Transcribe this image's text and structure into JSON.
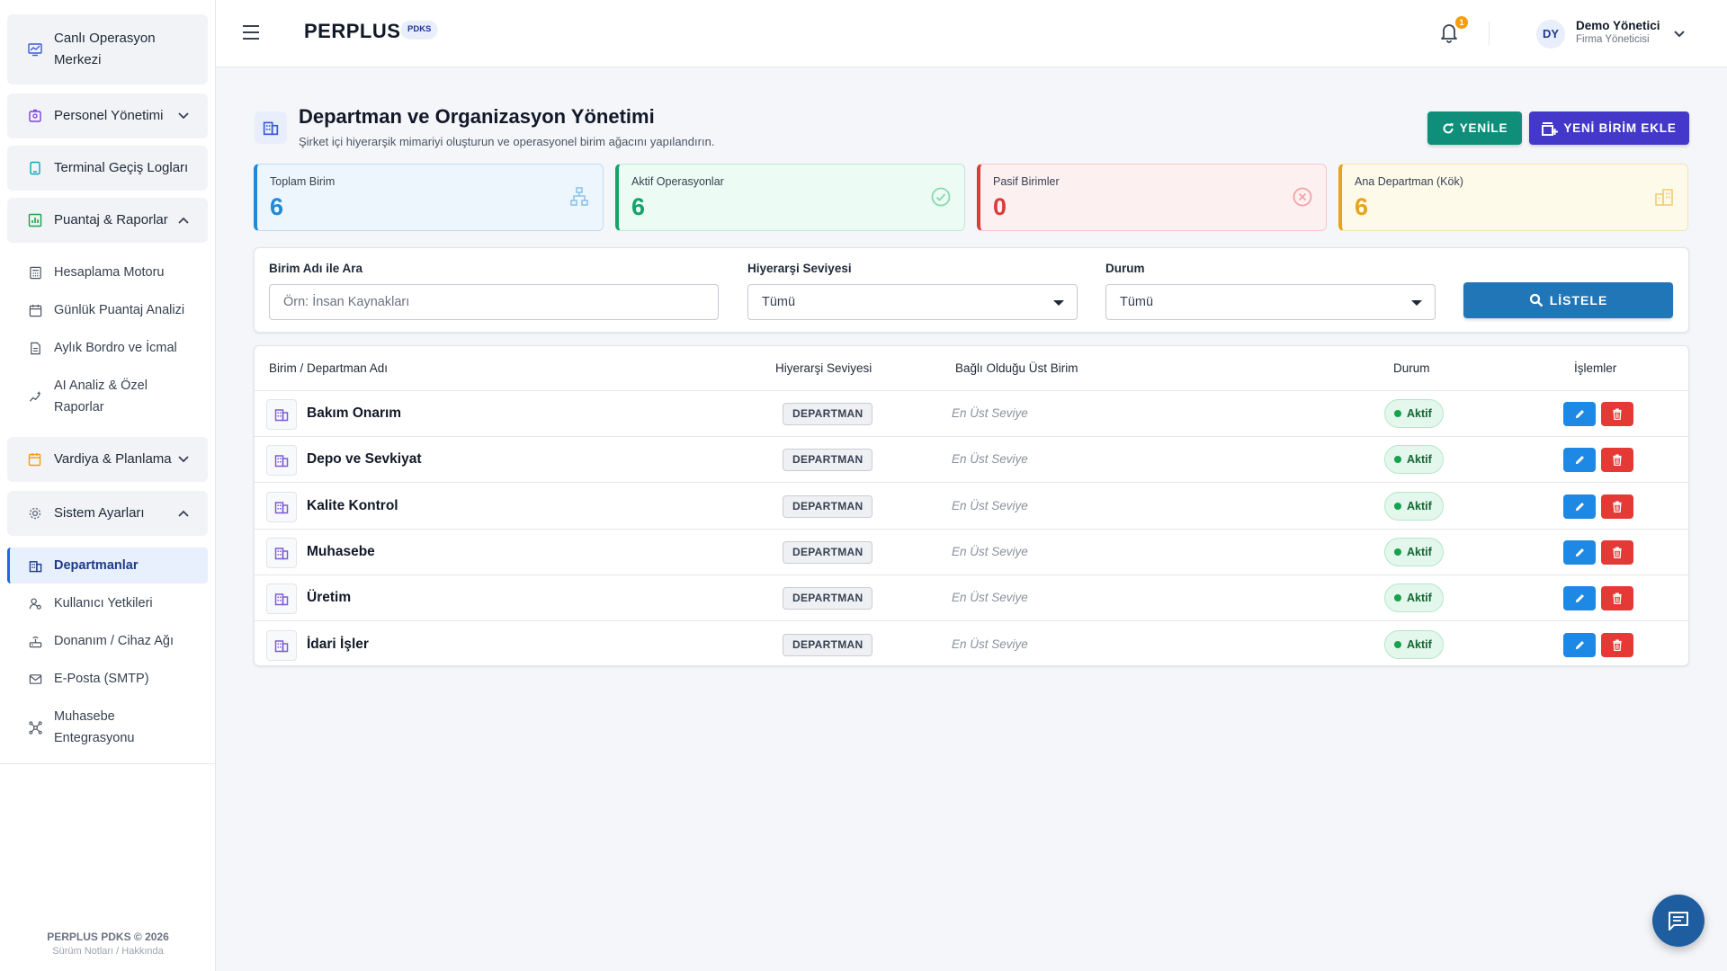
{
  "sidebar": {
    "items": [
      {
        "label_l1": "Canlı Operasyon",
        "label_l2": "Merkezi"
      },
      {
        "label": "Personel Yönetimi"
      },
      {
        "label": "Terminal Geçiş Logları"
      },
      {
        "label": "Puantaj & Raporlar"
      },
      {
        "label": "Vardiya & Planlama"
      },
      {
        "label": "Sistem Ayarları"
      }
    ],
    "puantaj_sub": [
      {
        "label": "Hesaplama Motoru"
      },
      {
        "label": "Günlük Puantaj Analizi"
      },
      {
        "label": "Aylık Bordro ve İcmal"
      },
      {
        "label_l1": "AI Analiz & Özel",
        "label_l2": "Raporlar"
      }
    ],
    "sistem_sub": [
      {
        "label": "Departmanlar"
      },
      {
        "label": "Kullanıcı Yetkileri"
      },
      {
        "label": "Donanım / Cihaz Ağı"
      },
      {
        "label": "E-Posta (SMTP)"
      },
      {
        "label_l1": "Muhasebe",
        "label_l2": "Entegrasyonu"
      }
    ],
    "footer": {
      "line1": "PERPLUS PDKS © 2026",
      "line2": "Sürüm Notları / Hakkında"
    }
  },
  "header": {
    "brand": "PERPLUS",
    "brand_badge": "PDKS",
    "notification_count": "1",
    "user": {
      "initials": "DY",
      "name": "Demo Yönetici",
      "role": "Firma Yöneticisi"
    }
  },
  "page": {
    "title": "Departman ve Organizasyon Yönetimi",
    "subtitle": "Şirket içi hiyerarşik mimariyi oluşturun ve operasyonel birim ağacını yapılandırın.",
    "refresh_label": "YENİLE",
    "add_label": "YENİ BİRİM EKLE"
  },
  "stats": [
    {
      "label": "Toplam Birim",
      "value": "6",
      "color": "#1f8ad8"
    },
    {
      "label": "Aktif Operasyonlar",
      "value": "6",
      "color": "#16a36a"
    },
    {
      "label": "Pasif Birimler",
      "value": "0",
      "color": "#dc3b3b"
    },
    {
      "label": "Ana Departman (Kök)",
      "value": "6",
      "color": "#e7a31a"
    }
  ],
  "filters": {
    "search_label": "Birim Adı ile Ara",
    "search_placeholder": "Örn: İnsan Kaynakları",
    "level_label": "Hiyerarşi Seviyesi",
    "level_value": "Tümü",
    "status_label": "Durum",
    "status_value": "Tümü",
    "list_label": "LİSTELE"
  },
  "table": {
    "headers": [
      "Birim / Departman Adı",
      "Hiyerarşi Seviyesi",
      "Bağlı Olduğu Üst Birim",
      "Durum",
      "İşlemler"
    ],
    "rows": [
      {
        "name": "Bakım Onarım",
        "type": "DEPARTMAN",
        "parent": "En Üst Seviye",
        "status": "Aktif"
      },
      {
        "name": "Depo ve Sevkiyat",
        "type": "DEPARTMAN",
        "parent": "En Üst Seviye",
        "status": "Aktif"
      },
      {
        "name": "Kalite Kontrol",
        "type": "DEPARTMAN",
        "parent": "En Üst Seviye",
        "status": "Aktif"
      },
      {
        "name": "Muhasebe",
        "type": "DEPARTMAN",
        "parent": "En Üst Seviye",
        "status": "Aktif"
      },
      {
        "name": "Üretim",
        "type": "DEPARTMAN",
        "parent": "En Üst Seviye",
        "status": "Aktif"
      },
      {
        "name": "İdari İşler",
        "type": "DEPARTMAN",
        "parent": "En Üst Seviye",
        "status": "Aktif"
      }
    ]
  },
  "colors": {
    "accent": "#2563eb",
    "refresh": "#0f8f7a",
    "add": "#4338ca",
    "list": "#2176b8",
    "edit": "#1e88e5",
    "delete": "#e53935"
  }
}
